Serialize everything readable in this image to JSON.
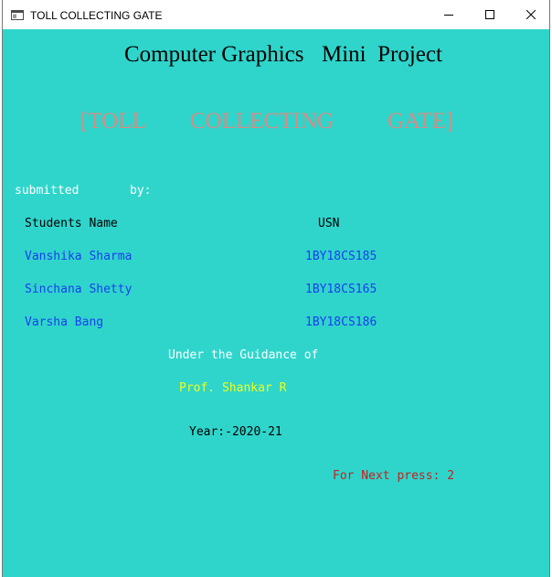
{
  "window": {
    "title": "TOLL COLLECTING GATE",
    "controls": {
      "minimize_icon": "minimize-icon",
      "maximize_icon": "maximize-icon",
      "close_icon": "close-icon"
    }
  },
  "content": {
    "heading_part1": "Computer Graphics",
    "heading_part2": "Mini  Project",
    "project_title_words": [
      "[TOLL",
      "COLLECTING",
      "GATE]"
    ],
    "submitted_label": "submitted",
    "by_label": "by:",
    "table": {
      "header_name": "Students Name",
      "header_usn": "USN",
      "rows": [
        {
          "name": "Vanshika Sharma",
          "usn": "1BY18CS185"
        },
        {
          "name": "Sinchana Shetty",
          "usn": "1BY18CS165"
        },
        {
          "name": "Varsha Bang",
          "usn": "1BY18CS186"
        }
      ]
    },
    "guidance_label": "Under the Guidance of",
    "guide_name": "Prof. Shankar R",
    "year": "Year:-2020-21",
    "next_prompt": "For Next press: 2"
  },
  "colors": {
    "background": "#2fd5cb",
    "project_title": "#d98a82",
    "student_text": "#1a3ef0",
    "guide_text": "#f0ff1a",
    "next_prompt": "#c81f1f",
    "label_text": "#ffffff"
  }
}
